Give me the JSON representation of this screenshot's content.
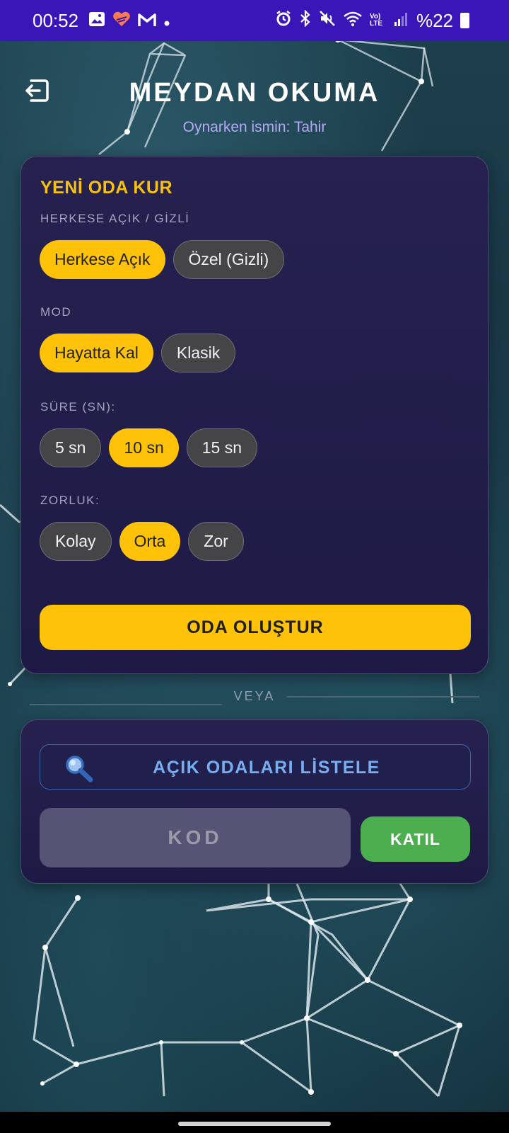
{
  "status_bar": {
    "time": "00:52",
    "battery": "%22",
    "left_icons": [
      "gallery-icon",
      "heart-app-icon",
      "gmail-icon",
      "dot-icon"
    ],
    "right_icons": [
      "alarm-icon",
      "bluetooth-icon",
      "mute-icon",
      "wifi-icon",
      "volte-icon",
      "signal-icon",
      "battery-icon"
    ],
    "volte_label": "Vo) LTE"
  },
  "header": {
    "title": "MEYDAN OKUMA",
    "subtitle": "Oynarken ismin: Tahir"
  },
  "create_room": {
    "title": "YENİ ODA KUR",
    "visibility": {
      "label": "HERKESE AÇIK / GİZLİ",
      "options": [
        "Herkese Açık",
        "Özel (Gizli)"
      ],
      "selected": "Herkese Açık"
    },
    "mode": {
      "label": "MOD",
      "options": [
        "Hayatta Kal",
        "Klasik"
      ],
      "selected": "Hayatta Kal"
    },
    "duration": {
      "label": "SÜRE (SN):",
      "options": [
        "5 sn",
        "10 sn",
        "15 sn"
      ],
      "selected": "10 sn"
    },
    "difficulty": {
      "label": "ZORLUK:",
      "options": [
        "Kolay",
        "Orta",
        "Zor"
      ],
      "selected": "Orta"
    },
    "create_button": "ODA OLUŞTUR"
  },
  "divider_text": "VEYA",
  "join_room": {
    "list_button": "AÇIK ODALARI LİSTELE",
    "code_placeholder": "KOD",
    "join_button": "KATIL"
  },
  "colors": {
    "accent": "#fec209",
    "status_bar": "#3a16b8",
    "join": "#4cae4f",
    "link": "#77aef2"
  }
}
